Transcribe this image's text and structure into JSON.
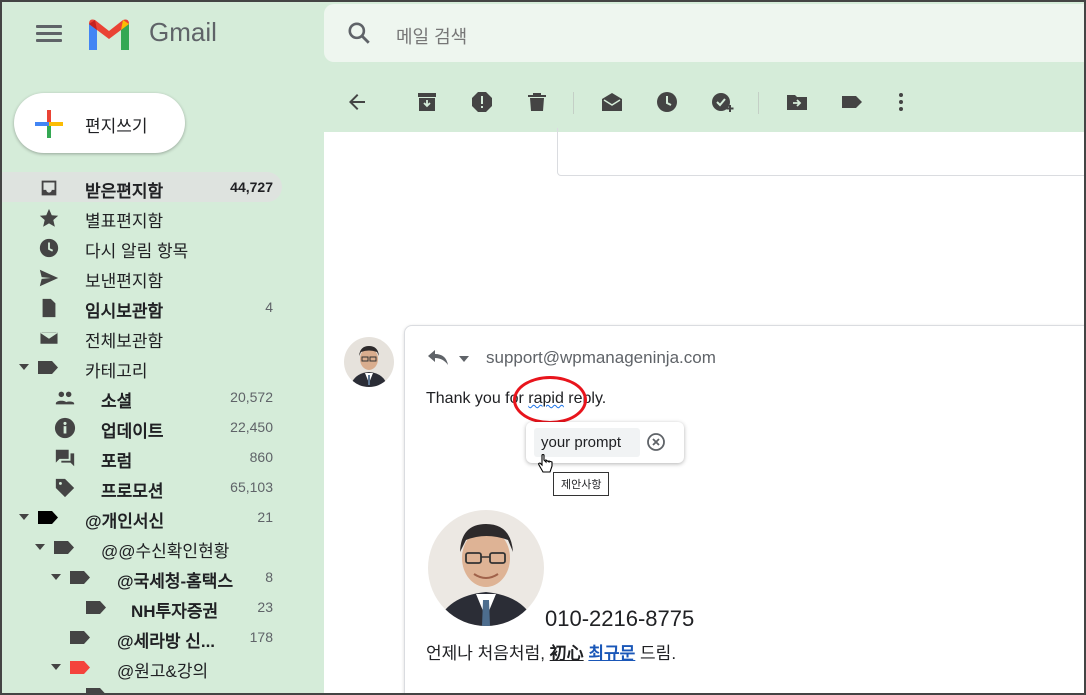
{
  "app": {
    "name": "Gmail"
  },
  "search": {
    "placeholder": "메일 검색"
  },
  "compose": {
    "label": "편지쓰기"
  },
  "sidebar": {
    "items": [
      {
        "label": "받은편지함",
        "count": "44,727"
      },
      {
        "label": "별표편지함",
        "count": ""
      },
      {
        "label": "다시 알림 항목",
        "count": ""
      },
      {
        "label": "보낸편지함",
        "count": ""
      },
      {
        "label": "임시보관함",
        "count": "4"
      },
      {
        "label": "전체보관함",
        "count": ""
      },
      {
        "label": "카테고리",
        "count": ""
      },
      {
        "label": "소셜",
        "count": "20,572"
      },
      {
        "label": "업데이트",
        "count": "22,450"
      },
      {
        "label": "포럼",
        "count": "860"
      },
      {
        "label": "프로모션",
        "count": "65,103"
      },
      {
        "label": "@개인서신",
        "count": "21"
      },
      {
        "label": "@@수신확인현황",
        "count": ""
      },
      {
        "label": "@국세청-홈택스",
        "count": "8"
      },
      {
        "label": "NH투자증권",
        "count": "23"
      },
      {
        "label": "@세라방 신...",
        "count": "178"
      },
      {
        "label": "@원고&강의",
        "count": ""
      }
    ]
  },
  "toolbar": {
    "icons": [
      "back-arrow-icon",
      "archive-icon",
      "report-spam-icon",
      "delete-icon",
      "mark-unread-icon",
      "snooze-icon",
      "add-task-icon",
      "move-to-icon",
      "label-icon",
      "more-vert-icon"
    ]
  },
  "message": {
    "to": "support@wpmanageninja.com",
    "body_before": "Thank you for ",
    "body_misspelled": "rapid",
    "body_after": " reply.",
    "suggestion": "your prompt",
    "tooltip": "제안사항",
    "signature": {
      "phone": "010-2216-8775",
      "line_prefix": "언제나 처음처럼, ",
      "chinese": "初心",
      "name": "최규문",
      "line_suffix": " 드림."
    }
  },
  "colors": {
    "background": "#d5ecd9",
    "accent_red": "#e8141c",
    "link": "#1a57b8"
  }
}
